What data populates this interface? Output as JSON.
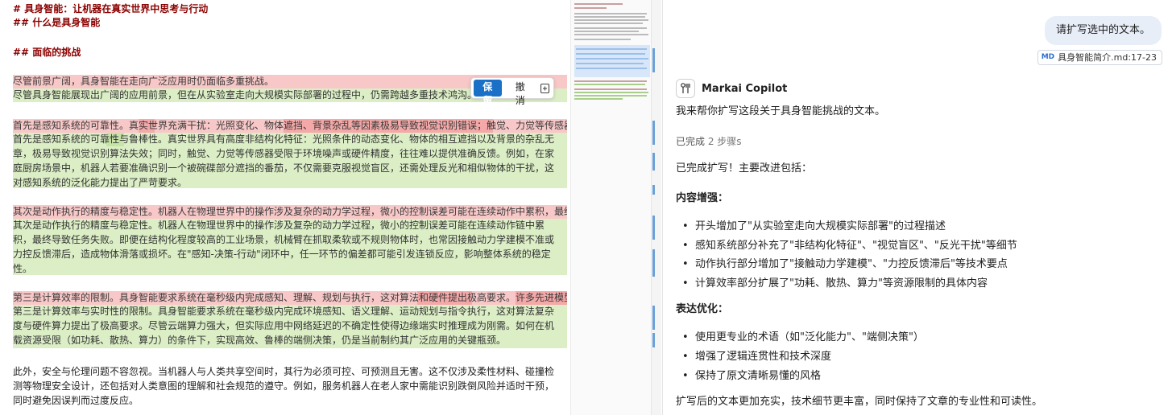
{
  "editor": {
    "heading1": "#  具身智能：让机器在真实世界中思考与行动",
    "heading2": "##  什么是具身智能",
    "heading3": "##  面临的挑战",
    "p1_del": "尽管前景广阔，具身智能在走向广泛应用时仍面临多重挑战。",
    "p1_ins": "尽管具身智能展现出广阔的应用前景，但在从实验室走向大规模实际部署的过程中，仍需跨越多重技术鸿沟。",
    "p2_del": "首先是感知系统的可靠性。真实世界充满干扰：光照变化、物体遮挡、背景杂乱等因素极易导致视觉识别错误；触觉、力觉等传感器也常因环境噪声或",
    "p2_ins": [
      "首先是感知系统的可靠性与鲁棒性。真实世界具有高度非结构化特征：光照条件的动态变化、物体的相互遮挡以及背景的杂乱无",
      "章，极易导致视觉识别算法失效；同时，触觉、力觉等传感器受限于环境噪声或硬件精度，往往难以提供准确反馈。例如，在家",
      "庭厨房场景中，机器人若要准确识别一个被碗碟部分遮挡的番茄，不仅需要克服视觉盲区，还需处理反光和相似物体的干扰，这",
      "对感知系统的泛化能力提出了严苛要求。"
    ],
    "p3_del": "其次是动作执行的精度与稳定性。机器人在物理世界中的操作涉及复杂的动力学过程，微小的控制误差可能在连续动作中累积，最终导致任务失败。即使",
    "p3_ins": [
      "其次是动作执行的精度与稳定性。机器人在物理世界中的操作涉及复杂的动力学过程，微小的控制误差可能在连续动作链中累",
      "积，最终导致任务失败。即便在结构化程度较高的工业场景，机械臂在抓取柔软或不规则物体时，也常因接触动力学建模不准或",
      "力控反馈滞后，造成物体滑落或损坏。在\"感知-决策-行动\"闭环中，任一环节的偏差都可能引发连锁反应，影响整体系统的稳定",
      "性。"
    ],
    "p4_del": "第三是计算效率的限制。具身智能要求系统在毫秒级内完成感知、理解、规划与执行，这对算法和硬件提出极高要求。许多先进模型依赖云端算力，但",
    "p4_ins": [
      "第三是计算效率与实时性的限制。具身智能要求系统在毫秒级内完成环境感知、语义理解、运动规划与指令执行，这对算法复杂",
      "度与硬件算力提出了极高要求。尽管云端算力强大，但实际应用中网络延迟的不确定性使得边缘端实时推理成为刚需。如何在机",
      "载资源受限（如功耗、散热、算力）的条件下，实现高效、鲁棒的端侧决策，仍是当前制约其广泛应用的关键瓶颈。"
    ],
    "p5": [
      "此外，安全与伦理问题不容忽视。当机器人与人类共享空间时，其行为必须可控、可预测且无害。这不仅涉及柔性材料、碰撞检",
      "测等物理安全设计，还包括对人类意图的理解和社会规范的遵守。例如，服务机器人在老人家中需能识别跌倒风险并适时干预，",
      "同时避免因误判而过度反应。"
    ],
    "keep_label": "保留",
    "undo_label": "撤消"
  },
  "chat": {
    "user_message": "请扩写选中的文本。",
    "file_ref_badge": "MD",
    "file_ref": "具身智能简介.md:17-23",
    "assistant_name": "Markai Copilot",
    "intro": "我来帮你扩写这段关于具身智能挑战的文本。",
    "status": "已完成",
    "status_count": "2 步骤s",
    "done": "已完成扩写！主要改进包括：",
    "section1_title": "内容增强：",
    "section1_items": [
      "开头增加了\"从实验室走向大规模实际部署\"的过程描述",
      "感知系统部分补充了\"非结构化特征\"、\"视觉盲区\"、\"反光干扰\"等细节",
      "动作执行部分增加了\"接触动力学建模\"、\"力控反馈滞后\"等技术要点",
      "计算效率部分扩展了\"功耗、散热、算力\"等资源限制的具体内容"
    ],
    "section2_title": "表达优化：",
    "section2_items": [
      "使用更专业的术语（如\"泛化能力\"、\"端侧决策\"）",
      "增强了逻辑连贯性和技术深度",
      "保持了原文清晰易懂的风格"
    ],
    "summary": "扩写后的文本更加充实，技术细节更丰富，同时保持了文章的专业性和可读性。"
  },
  "colors": {
    "deleted_line": "#f8c8c8",
    "inserted_block": "#dbeec5",
    "heading": "#8b0000",
    "keep_button": "#1a6fc6"
  }
}
